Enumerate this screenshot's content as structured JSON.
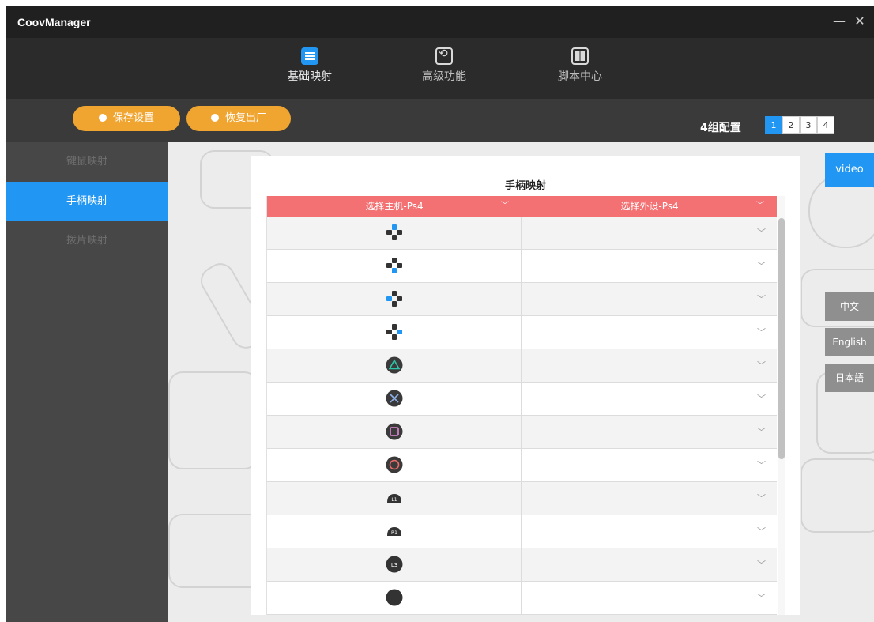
{
  "app": {
    "title": "CoovManager",
    "minimize": "—",
    "close": "✕"
  },
  "nav": {
    "items": [
      {
        "label": "基础映射",
        "icon": "keyboard-icon"
      },
      {
        "label": "高级功能",
        "icon": "advanced-icon"
      },
      {
        "label": "脚本中心",
        "icon": "script-icon"
      }
    ],
    "active_index": 0
  },
  "toolbar": {
    "save_label": "保存设置",
    "reset_label": "恢复出厂",
    "config_label": "4组配置",
    "config_tabs": [
      "1",
      "2",
      "3",
      "4"
    ],
    "active_config": "1"
  },
  "sidebar": {
    "items": [
      {
        "label": "键鼠映射"
      },
      {
        "label": "手柄映射"
      },
      {
        "label": "拨片映射"
      }
    ],
    "active_index": 1
  },
  "panel": {
    "title": "手柄映射",
    "host_select": "选择主机-Ps4",
    "device_select": "选择外设-Ps4",
    "rows": [
      {
        "button": "dpad-up-icon"
      },
      {
        "button": "dpad-down-icon"
      },
      {
        "button": "dpad-left-icon"
      },
      {
        "button": "dpad-right-icon"
      },
      {
        "button": "triangle-button-icon"
      },
      {
        "button": "cross-button-icon"
      },
      {
        "button": "square-button-icon"
      },
      {
        "button": "circle-button-icon"
      },
      {
        "button": "l1-button-icon",
        "text": "L1"
      },
      {
        "button": "r1-button-icon",
        "text": "R1"
      },
      {
        "button": "l3-button-icon",
        "text": "L3"
      },
      {
        "button": "r3-button-icon",
        "text": ""
      }
    ]
  },
  "right": {
    "video_label": "video",
    "languages": [
      "中文",
      "English",
      "日本語"
    ]
  },
  "colors": {
    "accent_blue": "#2196f3",
    "orange": "#f0a530",
    "header_red": "#f37173",
    "triangle": "#2ec4a8",
    "cross": "#8fb1e8",
    "square": "#e08ad6",
    "circle": "#f06a6a"
  }
}
